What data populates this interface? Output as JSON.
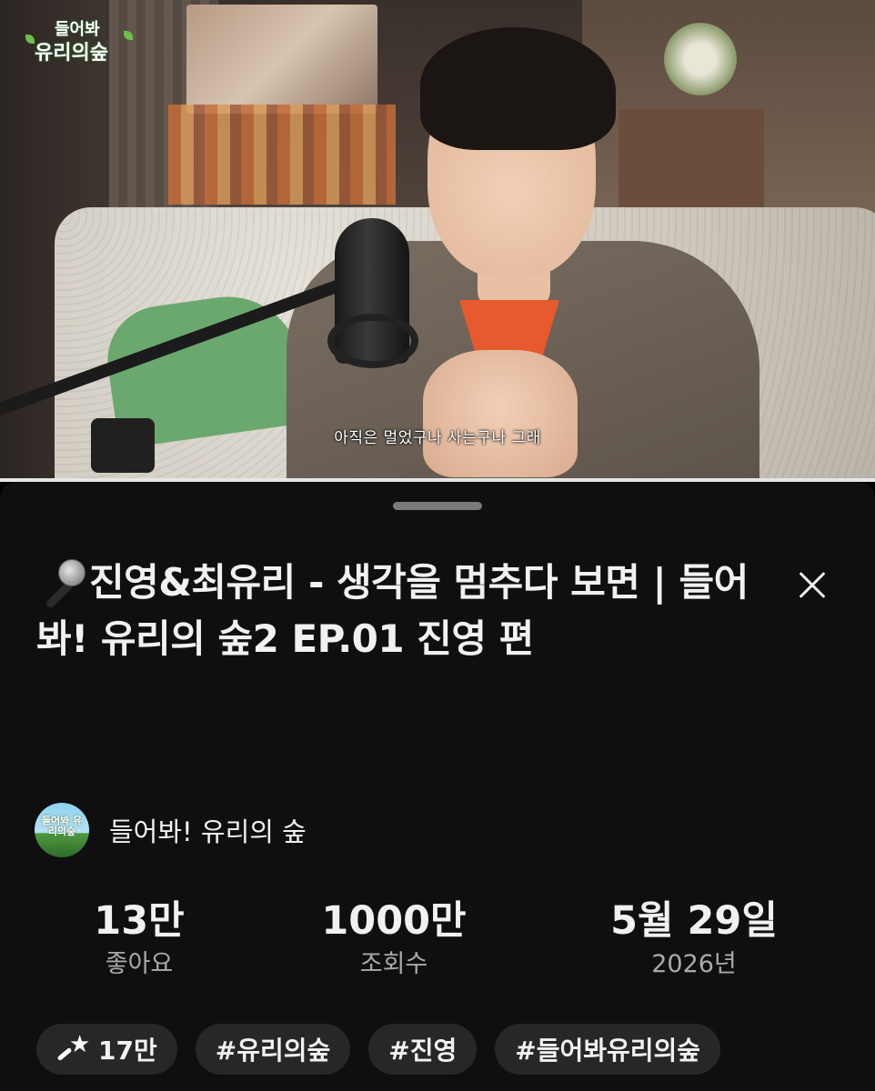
{
  "video": {
    "logo_line1": "들어봐",
    "logo_line2": "유리의숲",
    "subtitle": "아직은 멀었구나 사는구나 그래"
  },
  "sheet": {
    "title": "진영&최유리 - 생각을 멈추다 보면 | 들어봐! 유리의 숲2 EP.01 진영 편",
    "title_icon": "microphone-emoji",
    "channel": {
      "avatar_text": "들어봐 유리의숲",
      "name": "들어봐! 유리의 숲"
    },
    "stats": [
      {
        "value": "13만",
        "label": "좋아요"
      },
      {
        "value": "1000만",
        "label": "조회수"
      },
      {
        "value": "5월 29일",
        "label": "2026년"
      }
    ],
    "chips": [
      {
        "label": "17만",
        "icon": "thanks-star-icon"
      },
      {
        "label": "#유리의숲"
      },
      {
        "label": "#진영"
      },
      {
        "label": "#들어봐유리의숲"
      }
    ]
  },
  "colors": {
    "background": "#0f0f0f",
    "chip": "#272727",
    "secondary_text": "#aaaaaa"
  }
}
